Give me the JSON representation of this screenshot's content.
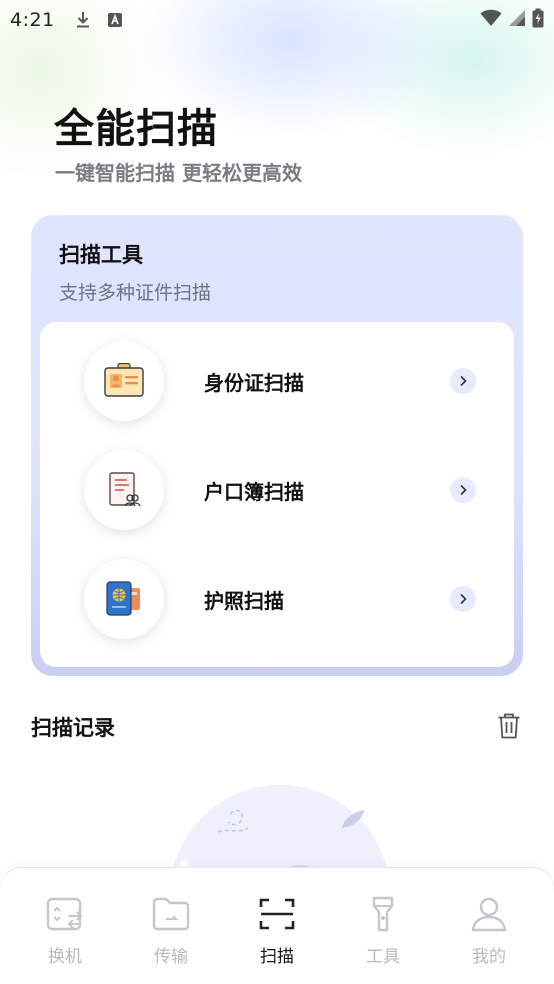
{
  "status_bar": {
    "time": "4:21"
  },
  "hero": {
    "title": "全能扫描",
    "subtitle": "一键智能扫描 更轻松更高效"
  },
  "tools": {
    "title": "扫描工具",
    "subtitle": "支持多种证件扫描",
    "items": [
      {
        "label": "身份证扫描",
        "icon": "id-card-icon"
      },
      {
        "label": "户口簿扫描",
        "icon": "household-register-icon"
      },
      {
        "label": "护照扫描",
        "icon": "passport-icon"
      }
    ]
  },
  "records": {
    "title": "扫描记录"
  },
  "nav": {
    "items": [
      {
        "label": "换机",
        "icon": "phone-switch-icon",
        "active": false
      },
      {
        "label": "传输",
        "icon": "folder-transfer-icon",
        "active": false
      },
      {
        "label": "扫描",
        "icon": "scan-icon",
        "active": true
      },
      {
        "label": "工具",
        "icon": "flashlight-icon",
        "active": false
      },
      {
        "label": "我的",
        "icon": "user-icon",
        "active": false
      }
    ]
  },
  "colors": {
    "accent": "#5b6cf0",
    "card_bg": "#dde2fb",
    "inactive_nav": "#b7b9c2"
  }
}
